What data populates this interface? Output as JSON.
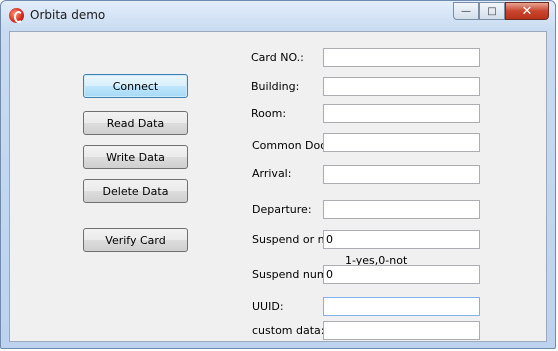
{
  "window": {
    "title": "Orbita demo"
  },
  "caption": {
    "minimize": "—",
    "maximize": "□",
    "close": "✕"
  },
  "buttons": {
    "connect": "Connect",
    "read": "Read Data",
    "write": "Write Data",
    "delete": "Delete Data",
    "verify": "Verify Card"
  },
  "form": {
    "card_no": {
      "label": "Card NO.:",
      "value": ""
    },
    "building": {
      "label": "Building:",
      "value": ""
    },
    "room": {
      "label": "Room:",
      "value": ""
    },
    "common_doors": {
      "label": "Common Doors:",
      "value": ""
    },
    "arrival": {
      "label": "Arrival:",
      "value": ""
    },
    "departure": {
      "label": "Departure:",
      "value": ""
    },
    "suspend_or_not": {
      "label": "Suspend or not:",
      "value": "0",
      "hint": "1-yes,0-not"
    },
    "suspend_number": {
      "label": "Suspend number",
      "value": "0"
    },
    "uuid": {
      "label": "UUID:",
      "value": ""
    },
    "custom_data": {
      "label": "custom data:",
      "value": ""
    }
  }
}
